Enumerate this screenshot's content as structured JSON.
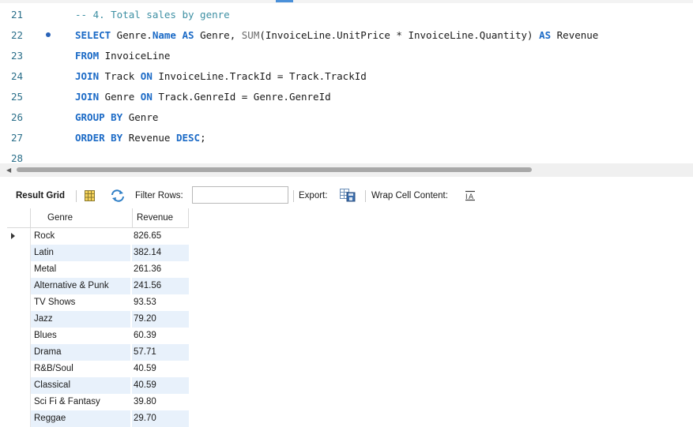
{
  "editor": {
    "lines": [
      {
        "num": "21",
        "marker": false,
        "parts": [
          {
            "t": "-- 4. Total sales by genre",
            "c": "cm"
          }
        ]
      },
      {
        "num": "22",
        "marker": true,
        "parts": [
          {
            "t": "SELECT",
            "c": "kw"
          },
          {
            "t": " Genre.",
            "c": ""
          },
          {
            "t": "Name",
            "c": "kw"
          },
          {
            "t": " ",
            "c": ""
          },
          {
            "t": "AS",
            "c": "kw"
          },
          {
            "t": " Genre, ",
            "c": ""
          },
          {
            "t": "SUM",
            "c": "fn"
          },
          {
            "t": "(InvoiceLine.UnitPrice * InvoiceLine.Quantity) ",
            "c": ""
          },
          {
            "t": "AS",
            "c": "kw"
          },
          {
            "t": " Revenue",
            "c": ""
          }
        ]
      },
      {
        "num": "23",
        "marker": false,
        "parts": [
          {
            "t": "FROM",
            "c": "kw"
          },
          {
            "t": " InvoiceLine",
            "c": ""
          }
        ]
      },
      {
        "num": "24",
        "marker": false,
        "parts": [
          {
            "t": "JOIN",
            "c": "kw"
          },
          {
            "t": " Track ",
            "c": ""
          },
          {
            "t": "ON",
            "c": "kw"
          },
          {
            "t": " InvoiceLine.TrackId = Track.TrackId",
            "c": ""
          }
        ]
      },
      {
        "num": "25",
        "marker": false,
        "parts": [
          {
            "t": "JOIN",
            "c": "kw"
          },
          {
            "t": " Genre ",
            "c": ""
          },
          {
            "t": "ON",
            "c": "kw"
          },
          {
            "t": " Track.GenreId = Genre.GenreId",
            "c": ""
          }
        ]
      },
      {
        "num": "26",
        "marker": false,
        "parts": [
          {
            "t": "GROUP BY",
            "c": "kw"
          },
          {
            "t": " Genre",
            "c": ""
          }
        ]
      },
      {
        "num": "27",
        "marker": false,
        "parts": [
          {
            "t": "ORDER BY",
            "c": "kw"
          },
          {
            "t": " Revenue ",
            "c": ""
          },
          {
            "t": "DESC",
            "c": "kw"
          },
          {
            "t": ";",
            "c": ""
          }
        ]
      },
      {
        "num": "28",
        "marker": false,
        "parts": []
      }
    ]
  },
  "toolbar": {
    "result_grid_label": "Result Grid",
    "filter_label": "Filter Rows:",
    "filter_value": "",
    "export_label": "Export:",
    "wrap_label": "Wrap Cell Content:"
  },
  "grid": {
    "columns": [
      "Genre",
      "Revenue"
    ],
    "rows": [
      {
        "genre": "Rock",
        "revenue": "826.65"
      },
      {
        "genre": "Latin",
        "revenue": "382.14"
      },
      {
        "genre": "Metal",
        "revenue": "261.36"
      },
      {
        "genre": "Alternative & Punk",
        "revenue": "241.56"
      },
      {
        "genre": "TV Shows",
        "revenue": "93.53"
      },
      {
        "genre": "Jazz",
        "revenue": "79.20"
      },
      {
        "genre": "Blues",
        "revenue": "60.39"
      },
      {
        "genre": "Drama",
        "revenue": "57.71"
      },
      {
        "genre": "R&B/Soul",
        "revenue": "40.59"
      },
      {
        "genre": "Classical",
        "revenue": "40.59"
      },
      {
        "genre": "Sci Fi & Fantasy",
        "revenue": "39.80"
      },
      {
        "genre": "Reggae",
        "revenue": "29.70"
      }
    ],
    "selected_row": 0
  },
  "colors": {
    "keyword": "#1b6ac6",
    "comment": "#3d8fa3",
    "line_number": "#2b6f8a",
    "alt_row": "#e8f1fb"
  }
}
